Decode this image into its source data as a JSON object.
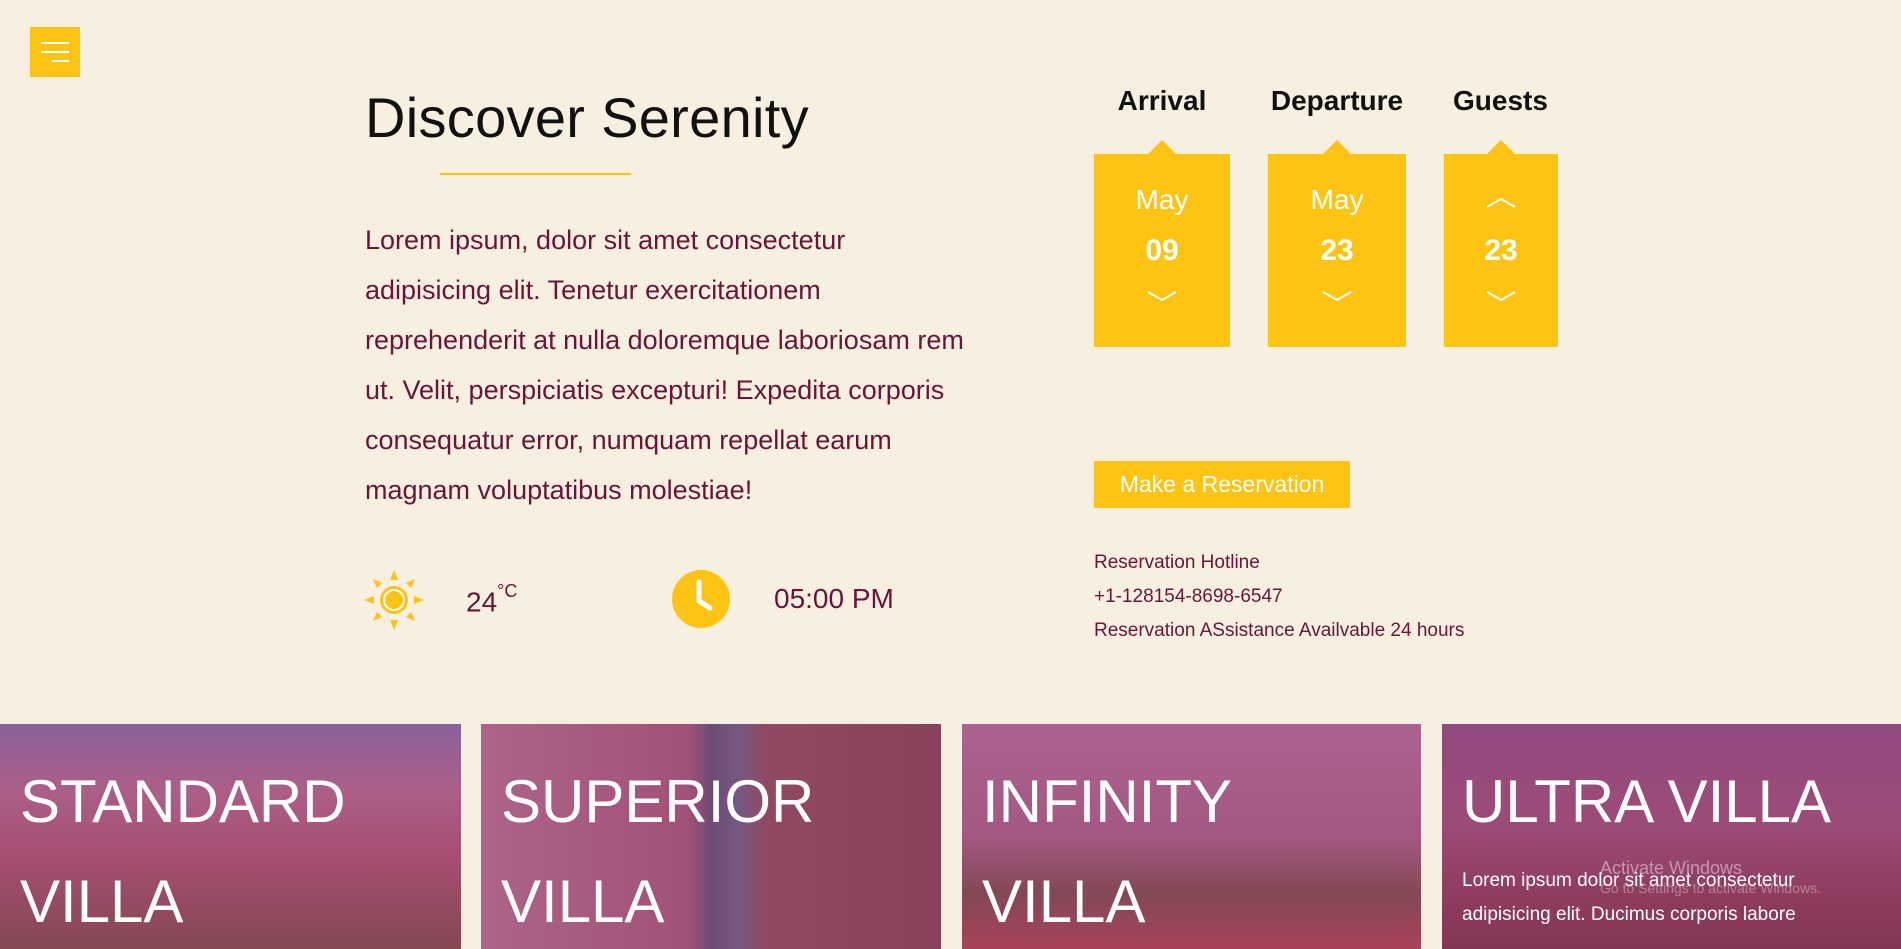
{
  "menu": {
    "icon": "hamburger-menu-icon"
  },
  "hero": {
    "title": "Discover Serenity",
    "text": "Lorem ipsum, dolor sit amet consectetur adipisicing elit. Tenetur exercitationem reprehenderit at nulla doloremque laboriosam rem ut. Velit, perspiciatis excepturi! Expedita corporis consequatur error, numquam repellat earum magnam voluptatibus molestiae!"
  },
  "weather": {
    "temp": "24",
    "unit": "°C",
    "icon": "sun-icon"
  },
  "clock": {
    "time": "05:00 PM",
    "icon": "clock-icon"
  },
  "booking": {
    "arrival": {
      "label": "Arrival",
      "month": "May",
      "day": "09"
    },
    "departure": {
      "label": "Departure",
      "month": "May",
      "day": "23"
    },
    "guests": {
      "label": "Guests",
      "count": "23"
    },
    "button": "Make a Reservation",
    "hotline_label": "Reservation Hotline",
    "hotline_phone": "+1-128154-8698-6547",
    "assistance": "Reservation ASsistance Availvable 24 hours"
  },
  "villas": [
    {
      "name": "STANDARD VILLA"
    },
    {
      "name": "SUPERIOR VILLA"
    },
    {
      "name": "INFINITY VILLA"
    },
    {
      "name": "ULTRA VILLA",
      "desc": "Lorem ipsum dolor sit amet consectetur adipisicing elit. Ducimus corporis labore"
    }
  ],
  "watermark": {
    "title": "Activate Windows",
    "sub": "Go to Settings to activate Windows."
  },
  "colors": {
    "accent": "#fdc414",
    "text": "#6b1439",
    "background": "#f7efe0"
  }
}
